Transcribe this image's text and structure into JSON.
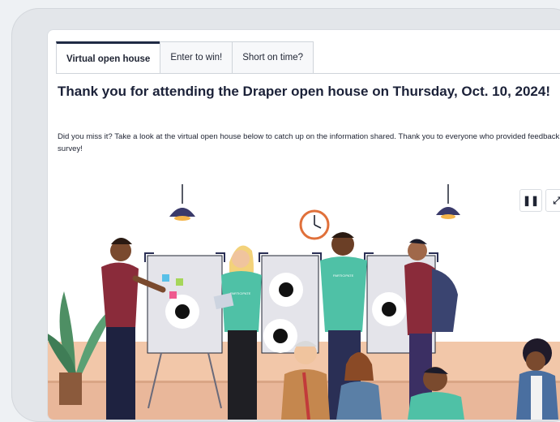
{
  "tabs": [
    {
      "label": "Virtual open house",
      "active": true
    },
    {
      "label": "Enter to win!",
      "active": false
    },
    {
      "label": "Short on time?",
      "active": false
    }
  ],
  "content": {
    "title": "Thank you for attending the Draper open house on Thursday, Oct. 10, 2024!",
    "description": "Did you miss it? Take a look at the virtual open house below to catch up on the information shared. Thank you to everyone who provided feedback in the survey!"
  },
  "video": {
    "shirt_text": "PARTICIPATE",
    "controls": {
      "pause_icon": "pause-icon",
      "fullscreen_icon": "fullscreen-icon"
    }
  },
  "colors": {
    "accent": "#1f2a44",
    "shirt": "#4fc1a6",
    "floor": "#e9b79a"
  }
}
